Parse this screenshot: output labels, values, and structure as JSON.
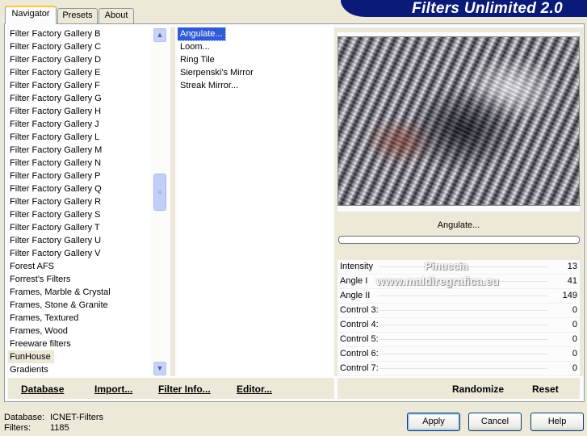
{
  "header": {
    "title": "Filters Unlimited 2.0"
  },
  "tabs": [
    {
      "label": "Navigator",
      "active": true
    },
    {
      "label": "Presets",
      "active": false
    },
    {
      "label": "About",
      "active": false
    }
  ],
  "categories": [
    "Filter Factory Gallery B",
    "Filter Factory Gallery C",
    "Filter Factory Gallery D",
    "Filter Factory Gallery E",
    "Filter Factory Gallery F",
    "Filter Factory Gallery G",
    "Filter Factory Gallery H",
    "Filter Factory Gallery J",
    "Filter Factory Gallery L",
    "Filter Factory Gallery M",
    "Filter Factory Gallery N",
    "Filter Factory Gallery P",
    "Filter Factory Gallery Q",
    "Filter Factory Gallery R",
    "Filter Factory Gallery S",
    "Filter Factory Gallery T",
    "Filter Factory Gallery U",
    "Filter Factory Gallery V",
    "Forest AFS",
    "Forrest's Filters",
    "Frames, Marble & Crystal",
    "Frames, Stone & Granite",
    "Frames, Textured",
    "Frames, Wood",
    "Freeware filters",
    "FunHouse",
    "Gradients"
  ],
  "selected_category": "FunHouse",
  "filters": [
    "Angulate...",
    "Loom...",
    "Ring Tile",
    "Sierpenski's Mirror",
    "Streak Mirror..."
  ],
  "selected_filter": "Angulate...",
  "preview": {
    "filter_name": "Angulate..."
  },
  "controls": [
    {
      "label": "Intensity",
      "value": "13"
    },
    {
      "label": "Angle I",
      "value": "41"
    },
    {
      "label": "Angle II",
      "value": "149"
    },
    {
      "label": "Control 3:",
      "value": "0"
    },
    {
      "label": "Control 4:",
      "value": "0"
    },
    {
      "label": "Control 5:",
      "value": "0"
    },
    {
      "label": "Control 6:",
      "value": "0"
    },
    {
      "label": "Control 7:",
      "value": "0"
    }
  ],
  "watermark": {
    "line1": "Pinuccia",
    "line2": "www.maldiregrafica.eu"
  },
  "toolbar": {
    "database": "Database",
    "import": "Import...",
    "filter_info": "Filter Info...",
    "editor": "Editor...",
    "randomize": "Randomize",
    "reset": "Reset"
  },
  "info": {
    "database_label": "Database:",
    "database_value": "ICNET-Filters",
    "filters_label": "Filters:",
    "filters_value": "1185"
  },
  "buttons": {
    "apply": "Apply",
    "cancel": "Cancel",
    "help": "Help"
  }
}
